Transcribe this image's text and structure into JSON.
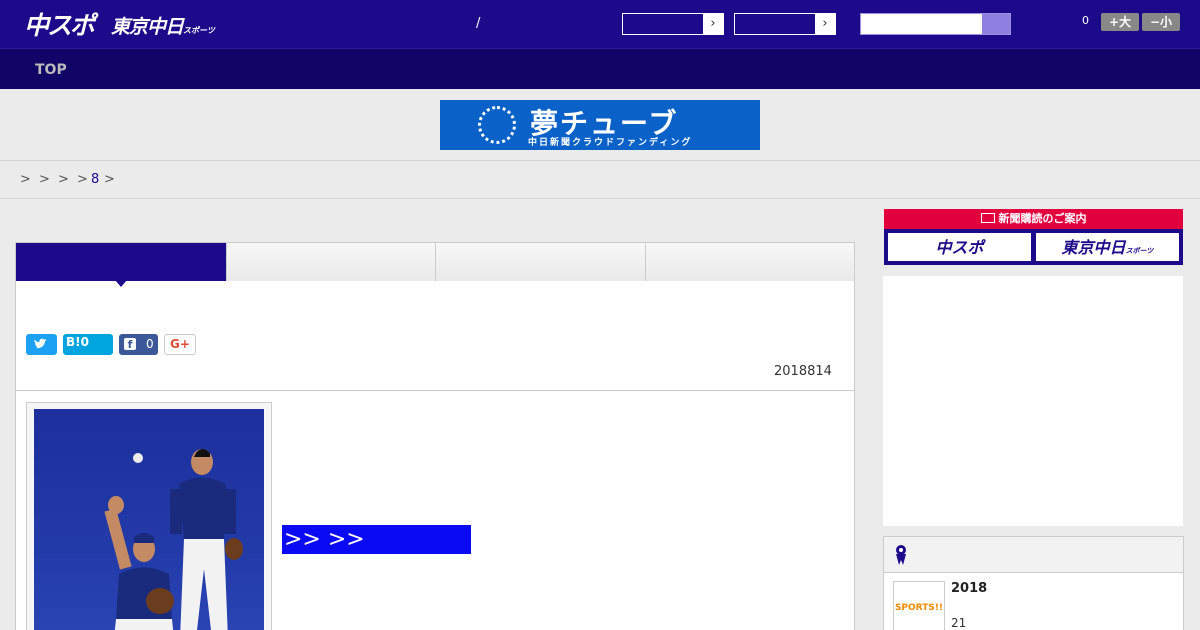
{
  "header": {
    "logo_chuspo": "中スポ",
    "logo_tokyo": "東京中日",
    "logo_tokyo_small": "スポーツ",
    "slash": "/",
    "select_arrow": "›",
    "font_count": "0",
    "font_larger": "+大",
    "font_smaller": "−小"
  },
  "nav": {
    "top": "TOP"
  },
  "banner": {
    "title": "夢チューブ",
    "subtitle": "中日新聞クラウドファンディング"
  },
  "breadcrumb": {
    "sep1": ">",
    "sep2": ">",
    "sep3": ">",
    "sep4": ">",
    "link": "8",
    "sep5": ">"
  },
  "social": {
    "twitter_icon": "twitter-bird",
    "hatena_label": "B!",
    "hatena_count": "0",
    "facebook_count": "0",
    "gplus_label": "G+"
  },
  "article": {
    "date": "2018814",
    "more_link": ">> >>"
  },
  "sidebar": {
    "subscribe_heading": "新聞購読のご案内",
    "subscribe_chuspo": "中スポ",
    "subscribe_tokyo": "東京中日",
    "subscribe_tokyo_small": "スポーツ",
    "ranking_item_title": "2018",
    "ranking_item_sub": "21",
    "ranking_thumb_text": "SPORTS!!"
  },
  "colors": {
    "header": "#1c0a8a",
    "nav": "#100566",
    "accent_red": "#e3003f",
    "link_blue": "#0a0af5"
  }
}
